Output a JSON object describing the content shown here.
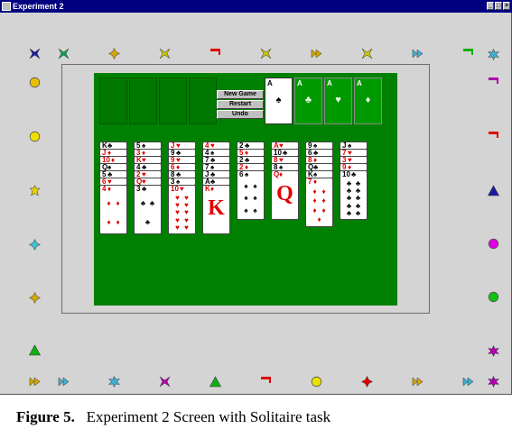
{
  "window": {
    "title": "Experiment 2",
    "controls": [
      "_",
      "□",
      "×"
    ]
  },
  "controls": {
    "new_game": "New Game",
    "restart": "Restart",
    "undo": "Undo"
  },
  "foundations": [
    {
      "rank": "A",
      "suit": "♠"
    },
    {
      "rank": "A",
      "suit": "♣"
    },
    {
      "rank": "A",
      "suit": "♥"
    },
    {
      "rank": "A",
      "suit": "♦"
    }
  ],
  "tableau": [
    [
      {
        "r": "K",
        "s": "♣"
      },
      {
        "r": "J",
        "s": "♦"
      },
      {
        "r": "10",
        "s": "♦"
      },
      {
        "r": "Q",
        "s": "♠"
      },
      {
        "r": "5",
        "s": "♣"
      },
      {
        "r": "6",
        "s": "♥"
      },
      {
        "r": "4",
        "s": "♦"
      }
    ],
    [
      {
        "r": "5",
        "s": "♠"
      },
      {
        "r": "3",
        "s": "♦"
      },
      {
        "r": "K",
        "s": "♥"
      },
      {
        "r": "4",
        "s": "♣"
      },
      {
        "r": "2",
        "s": "♥"
      },
      {
        "r": "Q",
        "s": "♥"
      },
      {
        "r": "3",
        "s": "♣"
      }
    ],
    [
      {
        "r": "J",
        "s": "♥"
      },
      {
        "r": "9",
        "s": "♣"
      },
      {
        "r": "9",
        "s": "♥"
      },
      {
        "r": "6",
        "s": "♦"
      },
      {
        "r": "8",
        "s": "♣"
      },
      {
        "r": "3",
        "s": "♠"
      },
      {
        "r": "10",
        "s": "♥"
      }
    ],
    [
      {
        "r": "4",
        "s": "♥"
      },
      {
        "r": "4",
        "s": "♠"
      },
      {
        "r": "7",
        "s": "♣"
      },
      {
        "r": "7",
        "s": "♠"
      },
      {
        "r": "J",
        "s": "♣"
      },
      {
        "r": "A",
        "s": "♣"
      },
      {
        "r": "K",
        "s": "♦"
      }
    ],
    [
      {
        "r": "2",
        "s": "♣"
      },
      {
        "r": "5",
        "s": "♦"
      },
      {
        "r": "2",
        "s": "♣"
      },
      {
        "r": "2",
        "s": "♦"
      },
      {
        "r": "6",
        "s": "♠"
      }
    ],
    [
      {
        "r": "A",
        "s": "♥"
      },
      {
        "r": "10",
        "s": "♣"
      },
      {
        "r": "8",
        "s": "♥"
      },
      {
        "r": "8",
        "s": "♠"
      },
      {
        "r": "Q",
        "s": "♦"
      }
    ],
    [
      {
        "r": "9",
        "s": "♠"
      },
      {
        "r": "6",
        "s": "♣"
      },
      {
        "r": "8",
        "s": "♦"
      },
      {
        "r": "Q",
        "s": "♣"
      },
      {
        "r": "K",
        "s": "♠"
      },
      {
        "r": "7",
        "s": "♦"
      }
    ],
    [
      {
        "r": "J",
        "s": "♠"
      },
      {
        "r": "7",
        "s": "♥"
      },
      {
        "r": "3",
        "s": "♥"
      },
      {
        "r": "9",
        "s": "♦"
      },
      {
        "r": "10",
        "s": "♣"
      }
    ]
  ],
  "peripheral_shapes": [
    {
      "id": "t1",
      "shape": "bowtie",
      "color": "#1a1aa0"
    },
    {
      "id": "t2",
      "shape": "bowtie",
      "color": "#0aa050"
    },
    {
      "id": "t3",
      "shape": "diamond-star",
      "color": "#d4a800"
    },
    {
      "id": "t4",
      "shape": "bowtie",
      "color": "#c8c800"
    },
    {
      "id": "t5",
      "shape": "flag",
      "color": "#e00000"
    },
    {
      "id": "t6",
      "shape": "bowtie",
      "color": "#c8c800"
    },
    {
      "id": "t7",
      "shape": "arrow-right",
      "color": "#d4a800"
    },
    {
      "id": "t8",
      "shape": "bowtie",
      "color": "#c8c800"
    },
    {
      "id": "t9",
      "shape": "arrow-right",
      "color": "#40b0d0"
    },
    {
      "id": "t10",
      "shape": "flag",
      "color": "#10b010"
    },
    {
      "id": "t11",
      "shape": "gear",
      "color": "#40b0d0"
    },
    {
      "id": "l1",
      "shape": "circle",
      "color": "#e8c000"
    },
    {
      "id": "l2",
      "shape": "circle",
      "color": "#f0e000"
    },
    {
      "id": "l3",
      "shape": "star",
      "color": "#e8d000"
    },
    {
      "id": "l4",
      "shape": "diamond-star",
      "color": "#40c0d0"
    },
    {
      "id": "l5",
      "shape": "diamond-star",
      "color": "#d4a800"
    },
    {
      "id": "l6",
      "shape": "triangle",
      "color": "#10b010"
    },
    {
      "id": "r1",
      "shape": "flag",
      "color": "#b000b0"
    },
    {
      "id": "r2",
      "shape": "flag",
      "color": "#e00000"
    },
    {
      "id": "r3",
      "shape": "triangle",
      "color": "#1a1aa0"
    },
    {
      "id": "r4",
      "shape": "circle",
      "color": "#e000e0"
    },
    {
      "id": "r5",
      "shape": "circle",
      "color": "#10c010"
    },
    {
      "id": "r6",
      "shape": "gear",
      "color": "#b000b0"
    },
    {
      "id": "b1",
      "shape": "arrow-right",
      "color": "#d4a800"
    },
    {
      "id": "b2",
      "shape": "arrow-right",
      "color": "#40b0d0"
    },
    {
      "id": "b3",
      "shape": "gear",
      "color": "#40b0d0"
    },
    {
      "id": "b4",
      "shape": "bowtie",
      "color": "#b000b0"
    },
    {
      "id": "b5",
      "shape": "triangle",
      "color": "#10b010"
    },
    {
      "id": "b6",
      "shape": "flag",
      "color": "#e00000"
    },
    {
      "id": "b7",
      "shape": "circle",
      "color": "#e8e000"
    },
    {
      "id": "b8",
      "shape": "diamond-star",
      "color": "#e00000"
    },
    {
      "id": "b9",
      "shape": "arrow-right",
      "color": "#d4a800"
    },
    {
      "id": "b10",
      "shape": "arrow-right",
      "color": "#40b0d0"
    },
    {
      "id": "b11",
      "shape": "gear",
      "color": "#b000b0"
    }
  ],
  "caption": {
    "label": "Figure 5.",
    "text": "Experiment 2 Screen with  Solitaire  task"
  }
}
